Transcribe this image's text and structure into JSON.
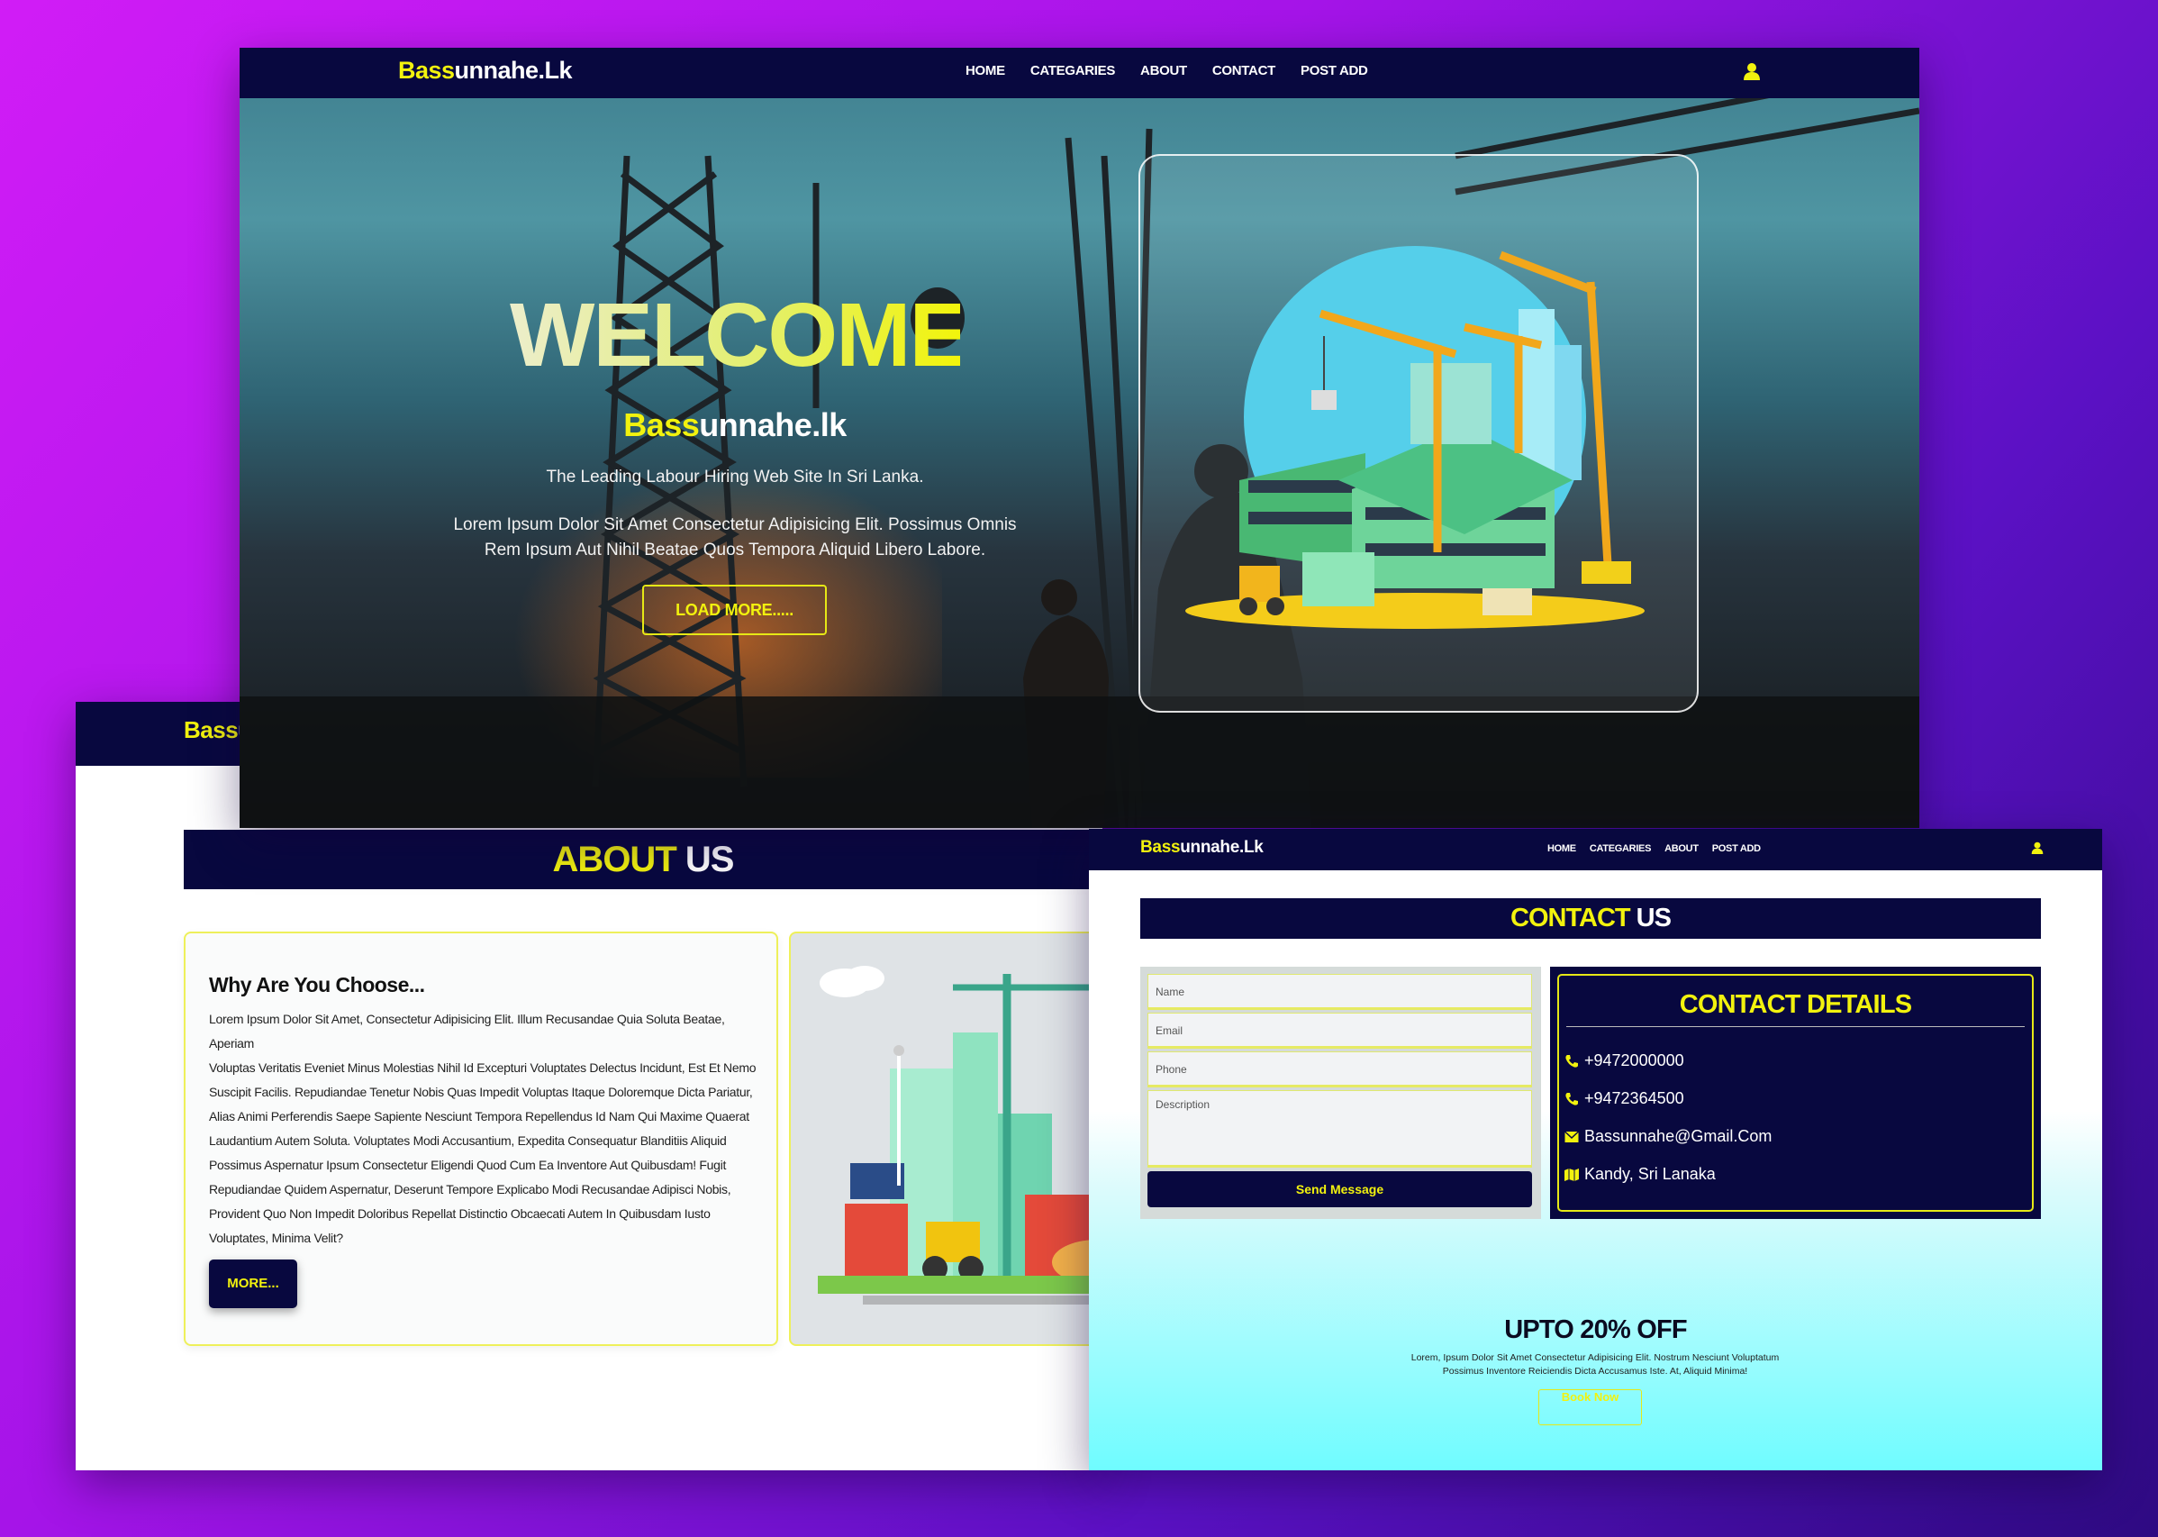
{
  "brand": {
    "highlight": "Bass",
    "rest": "unnahe.Lk",
    "rest_lower": "unnahe.lk"
  },
  "colors": {
    "navy": "#08083f",
    "yellow": "#f2f20e",
    "cyan": "#6ffcff",
    "backdrop_top": "#d11cf6",
    "backdrop_bottom": "#2e0a82"
  },
  "hero": {
    "nav": [
      "HOME",
      "CATEGARIES",
      "ABOUT",
      "CONTACT",
      "POST ADD"
    ],
    "user_icon": "user-icon",
    "welcome": "WELCOME",
    "tagline": "The Leading Labour Hiring Web Site In Sri Lanka.",
    "description_line1": "Lorem Ipsum Dolor Sit Amet Consectetur Adipisicing Elit. Possimus Omnis",
    "description_line2": "Rem Ipsum Aut Nihil Beatae Quos Tempora Aliquid Libero Labore.",
    "button": "LOAD MORE....."
  },
  "about": {
    "heading_yellow": "ABOUT",
    "heading_white": " US",
    "card_title": "Why Are You Choose...",
    "lines": [
      "Lorem Ipsum Dolor Sit Amet, Consectetur Adipisicing Elit. Illum Recusandae Quia Soluta Beatae, Aperiam",
      "Voluptas Veritatis Eveniet Minus Molestias Nihil Id Excepturi Voluptates Delectus Incidunt, Est Et Nemo",
      "Suscipit Facilis. Repudiandae Tenetur Nobis Quas Impedit Voluptas Itaque Doloremque Dicta Pariatur,",
      "Alias Animi Perferendis Saepe Sapiente Nesciunt Tempora Repellendus Id Nam Qui Maxime Quaerat",
      "Laudantium Autem Soluta. Voluptates Modi Accusantium, Expedita Consequatur Blanditiis Aliquid",
      "Possimus Aspernatur Ipsum Consectetur Eligendi Quod Cum Ea Inventore Aut Quibusdam! Fugit",
      "Repudiandae Quidem Aspernatur, Deserunt Tempore Explicabo Modi Recusandae Adipisci Nobis,",
      "Provident Quo Non Impedit Doloribus Repellat Distinctio Obcaecati Autem In Quibusdam Iusto",
      "Voluptates, Minima Velit?"
    ],
    "more_button": "MORE..."
  },
  "contact": {
    "nav": [
      "HOME",
      "CATEGARIES",
      "ABOUT",
      "POST ADD"
    ],
    "heading_yellow": "CONTACT",
    "heading_white": " US",
    "form": {
      "name": "Name",
      "email": "Email",
      "phone": "Phone",
      "description": "Description",
      "send": "Send Message"
    },
    "details_title": "CONTACT DETAILS",
    "details": [
      {
        "icon": "phone-icon",
        "text": "+9472000000"
      },
      {
        "icon": "phone-icon",
        "text": "+9472364500"
      },
      {
        "icon": "envelope-icon",
        "text": "Bassunnahe@Gmail.Com"
      },
      {
        "icon": "map-icon",
        "text": "Kandy, Sri Lanaka"
      }
    ],
    "promo_title": "UPTO 20% OFF",
    "promo_line1": "Lorem, Ipsum Dolor Sit Amet Consectetur Adipisicing Elit. Nostrum Nesciunt Voluptatum",
    "promo_line2": "Possimus Inventore Reiciendis Dicta Accusamus Iste. At, Aliquid Minima!",
    "promo_button": "Book Now"
  }
}
